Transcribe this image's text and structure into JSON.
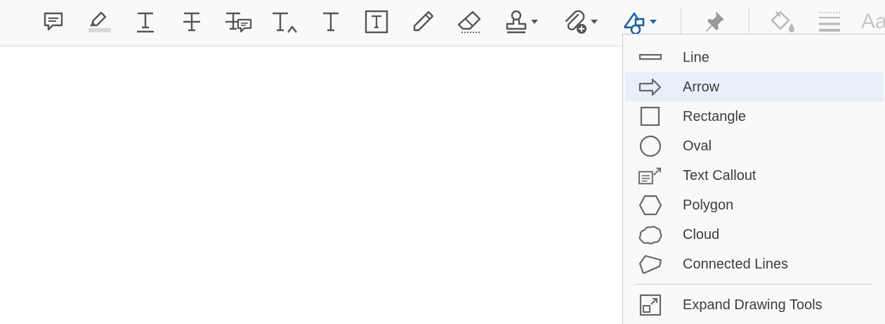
{
  "toolbar": {
    "tools": [
      {
        "icon": "comment-icon"
      },
      {
        "icon": "highlight-icon"
      },
      {
        "icon": "underline-text-icon"
      },
      {
        "icon": "strikethrough-icon"
      },
      {
        "icon": "replace-text-icon"
      },
      {
        "icon": "insert-text-icon"
      },
      {
        "icon": "add-text-icon"
      },
      {
        "icon": "text-box-icon"
      },
      {
        "icon": "pencil-icon"
      },
      {
        "icon": "eraser-icon"
      },
      {
        "icon": "stamp-icon"
      },
      {
        "icon": "attach-file-icon"
      },
      {
        "icon": "drawing-tools-icon",
        "active": true
      },
      {
        "icon": "pin-icon"
      },
      {
        "icon": "fill-color-icon"
      },
      {
        "icon": "line-width-icon"
      }
    ],
    "font_label": "Aa",
    "active_color": "#1a5fa8"
  },
  "menu": {
    "selected": "Arrow",
    "items": [
      {
        "label": "Line",
        "icon": "line-icon"
      },
      {
        "label": "Arrow",
        "icon": "arrow-icon"
      },
      {
        "label": "Rectangle",
        "icon": "rectangle-icon"
      },
      {
        "label": "Oval",
        "icon": "oval-icon"
      },
      {
        "label": "Text Callout",
        "icon": "text-callout-icon"
      },
      {
        "label": "Polygon",
        "icon": "polygon-icon"
      },
      {
        "label": "Cloud",
        "icon": "cloud-icon"
      },
      {
        "label": "Connected Lines",
        "icon": "connected-lines-icon"
      }
    ],
    "footer": {
      "label": "Expand Drawing Tools",
      "icon": "expand-icon"
    }
  }
}
